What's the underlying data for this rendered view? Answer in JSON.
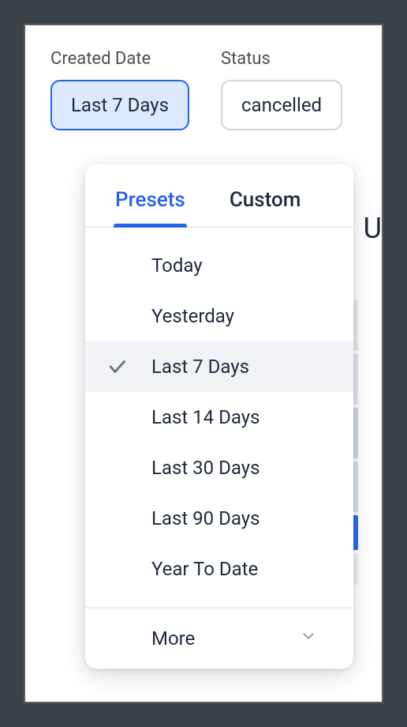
{
  "filters": {
    "created_date": {
      "label": "Created Date",
      "value": "Last 7 Days"
    },
    "status": {
      "label": "Status",
      "value": "cancelled"
    }
  },
  "dropdown": {
    "tabs": {
      "presets": "Presets",
      "custom": "Custom"
    },
    "presets": [
      {
        "label": "Today",
        "selected": false
      },
      {
        "label": "Yesterday",
        "selected": false
      },
      {
        "label": "Last 7 Days",
        "selected": true
      },
      {
        "label": "Last 14 Days",
        "selected": false
      },
      {
        "label": "Last 30 Days",
        "selected": false
      },
      {
        "label": "Last 90 Days",
        "selected": false
      },
      {
        "label": "Year To Date",
        "selected": false
      }
    ],
    "footer": {
      "label": "More"
    }
  },
  "background": {
    "letter": "U"
  }
}
